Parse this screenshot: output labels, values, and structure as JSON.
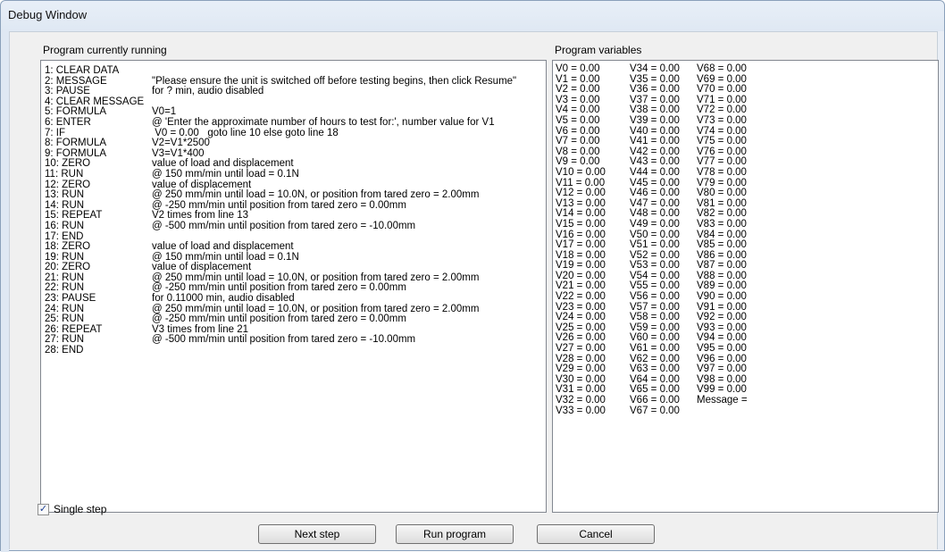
{
  "window": {
    "title": "Debug Window"
  },
  "program": {
    "label": "Program currently running",
    "lines": [
      {
        "cmd": "1: CLEAR DATA",
        "arg": ""
      },
      {
        "cmd": "2: MESSAGE",
        "arg": "\"Please ensure the unit is switched off before testing begins, then click Resume\""
      },
      {
        "cmd": "3: PAUSE",
        "arg": "for ? min, audio disabled"
      },
      {
        "cmd": "4: CLEAR MESSAGE",
        "arg": ""
      },
      {
        "cmd": "5: FORMULA",
        "arg": "V0=1"
      },
      {
        "cmd": "6: ENTER",
        "arg": "@ 'Enter the approximate number of hours to test for:', number value for V1"
      },
      {
        "cmd": "7: IF",
        "arg": " V0 = 0.00   goto line 10 else goto line 18"
      },
      {
        "cmd": "8: FORMULA",
        "arg": "V2=V1*2500"
      },
      {
        "cmd": "9: FORMULA",
        "arg": "V3=V1*400"
      },
      {
        "cmd": "10: ZERO",
        "arg": "value of load and displacement"
      },
      {
        "cmd": "11: RUN",
        "arg": "@ 150 mm/min until load = 0.1N"
      },
      {
        "cmd": "12: ZERO",
        "arg": "value of displacement"
      },
      {
        "cmd": "13: RUN",
        "arg": "@ 250 mm/min until load = 10.0N, or position from tared zero = 2.00mm"
      },
      {
        "cmd": "14: RUN",
        "arg": "@ -250 mm/min until position from tared zero = 0.00mm"
      },
      {
        "cmd": "15: REPEAT",
        "arg": "V2 times from line 13"
      },
      {
        "cmd": "16: RUN",
        "arg": "@ -500 mm/min until position from tared zero = -10.00mm"
      },
      {
        "cmd": "17: END",
        "arg": ""
      },
      {
        "cmd": "18: ZERO",
        "arg": "value of load and displacement"
      },
      {
        "cmd": "19: RUN",
        "arg": "@ 150 mm/min until load = 0.1N"
      },
      {
        "cmd": "20: ZERO",
        "arg": "value of displacement"
      },
      {
        "cmd": "21: RUN",
        "arg": "@ 250 mm/min until load = 10.0N, or position from tared zero = 2.00mm"
      },
      {
        "cmd": "22: RUN",
        "arg": "@ -250 mm/min until position from tared zero = 0.00mm"
      },
      {
        "cmd": "23: PAUSE",
        "arg": "for 0.11000 min, audio disabled"
      },
      {
        "cmd": "24: RUN",
        "arg": "@ 250 mm/min until load = 10.0N, or position from tared zero = 2.00mm"
      },
      {
        "cmd": "25: RUN",
        "arg": "@ -250 mm/min until position from tared zero = 0.00mm"
      },
      {
        "cmd": "26: REPEAT",
        "arg": "V3 times from line 21"
      },
      {
        "cmd": "27: RUN",
        "arg": "@ -500 mm/min until position from tared zero = -10.00mm"
      },
      {
        "cmd": "28: END",
        "arg": ""
      }
    ]
  },
  "variables": {
    "label": "Program variables",
    "col1": [
      "V0 = 0.00",
      "V1 = 0.00",
      "V2 = 0.00",
      "V3 = 0.00",
      "V4 = 0.00",
      "V5 = 0.00",
      "V6 = 0.00",
      "V7 = 0.00",
      "V8 = 0.00",
      "V9 = 0.00",
      "V10 = 0.00",
      "V11 = 0.00",
      "V12 = 0.00",
      "V13 = 0.00",
      "V14 = 0.00",
      "V15 = 0.00",
      "V16 = 0.00",
      "V17 = 0.00",
      "V18 = 0.00",
      "V19 = 0.00",
      "V20 = 0.00",
      "V21 = 0.00",
      "V22 = 0.00",
      "V23 = 0.00",
      "V24 = 0.00",
      "V25 = 0.00",
      "V26 = 0.00",
      "V27 = 0.00",
      "V28 = 0.00",
      "V29 = 0.00",
      "V30 = 0.00",
      "V31 = 0.00",
      "V32 = 0.00",
      "V33 = 0.00"
    ],
    "col2": [
      "V34 = 0.00",
      "V35 = 0.00",
      "V36 = 0.00",
      "V37 = 0.00",
      "V38 = 0.00",
      "V39 = 0.00",
      "V40 = 0.00",
      "V41 = 0.00",
      "V42 = 0.00",
      "V43 = 0.00",
      "V44 = 0.00",
      "V45 = 0.00",
      "V46 = 0.00",
      "V47 = 0.00",
      "V48 = 0.00",
      "V49 = 0.00",
      "V50 = 0.00",
      "V51 = 0.00",
      "V52 = 0.00",
      "V53 = 0.00",
      "V54 = 0.00",
      "V55 = 0.00",
      "V56 = 0.00",
      "V57 = 0.00",
      "V58 = 0.00",
      "V59 = 0.00",
      "V60 = 0.00",
      "V61 = 0.00",
      "V62 = 0.00",
      "V63 = 0.00",
      "V64 = 0.00",
      "V65 = 0.00",
      "V66 = 0.00",
      "V67 = 0.00"
    ],
    "col3": [
      "V68 = 0.00",
      "V69 = 0.00",
      "V70 = 0.00",
      "V71 = 0.00",
      "V72 = 0.00",
      "V73 = 0.00",
      "V74 = 0.00",
      "V75 = 0.00",
      "V76 = 0.00",
      "V77 = 0.00",
      "V78 = 0.00",
      "V79 = 0.00",
      "V80 = 0.00",
      "V81 = 0.00",
      "V82 = 0.00",
      "V83 = 0.00",
      "V84 = 0.00",
      "V85 = 0.00",
      "V86 = 0.00",
      "V87 = 0.00",
      "V88 = 0.00",
      "V89 = 0.00",
      "V90 = 0.00",
      "V91 = 0.00",
      "V92 = 0.00",
      "V93 = 0.00",
      "V94 = 0.00",
      "V95 = 0.00",
      "V96 = 0.00",
      "V97 = 0.00",
      "V98 = 0.00",
      "V99 = 0.00",
      "Message ="
    ]
  },
  "controls": {
    "single_step_label": "Single step",
    "single_step_checked": true,
    "check_mark": "✓",
    "next_step_label": "Next step",
    "run_program_label": "Run program",
    "cancel_label": "Cancel"
  }
}
